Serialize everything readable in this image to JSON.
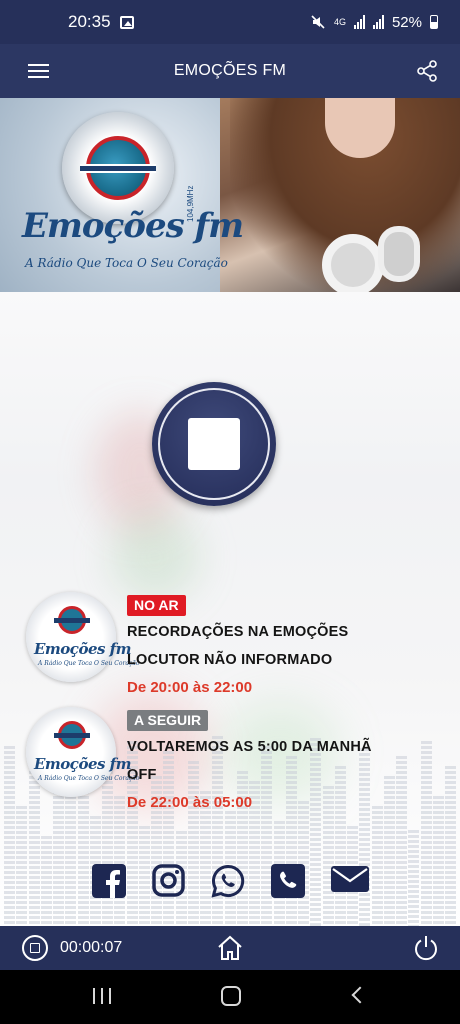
{
  "status_bar": {
    "time": "20:35",
    "network": "4G",
    "battery": "52%",
    "icons": [
      "gallery-icon",
      "mute-icon",
      "signal-icon",
      "battery-icon"
    ]
  },
  "app_bar": {
    "title": "EMOÇÕES FM",
    "icons": [
      "menu-icon",
      "share-icon"
    ]
  },
  "banner": {
    "logo_text": "Emoções fm",
    "frequency": "104,9MHz",
    "slogan": "A Rádio Que Toca O Seu Coração"
  },
  "player": {
    "state": "playing",
    "control_icon": "stop-icon"
  },
  "programs": [
    {
      "badge": "NO AR",
      "title": "RECORDAÇÕES NA EMOÇÕES",
      "host": "LOCUTOR NÃO INFORMADO",
      "time": "De 20:00 às 22:00",
      "logo_text": "Emoções fm",
      "logo_slogan": "A Rádio Que Toca O Seu Coração"
    },
    {
      "badge": "A SEGUIR",
      "title": "VOLTAREMOS AS 5:00 DA MANHÃ",
      "host": "OFF",
      "time": "De 22:00 às 05:00",
      "logo_text": "Emoções fm",
      "logo_slogan": "A Rádio Que Toca O Seu Coração"
    }
  ],
  "social": [
    "facebook-icon",
    "instagram-icon",
    "whatsapp-icon",
    "phone-icon",
    "email-icon"
  ],
  "bottom_bar": {
    "elapsed": "00:00:07",
    "icons": [
      "stop-icon",
      "home-icon",
      "power-icon"
    ]
  },
  "colors": {
    "primary": "#2c3763",
    "dark": "#26305a",
    "live": "#e01b24",
    "next": "#7a7d80",
    "time": "#dd3a2a"
  }
}
